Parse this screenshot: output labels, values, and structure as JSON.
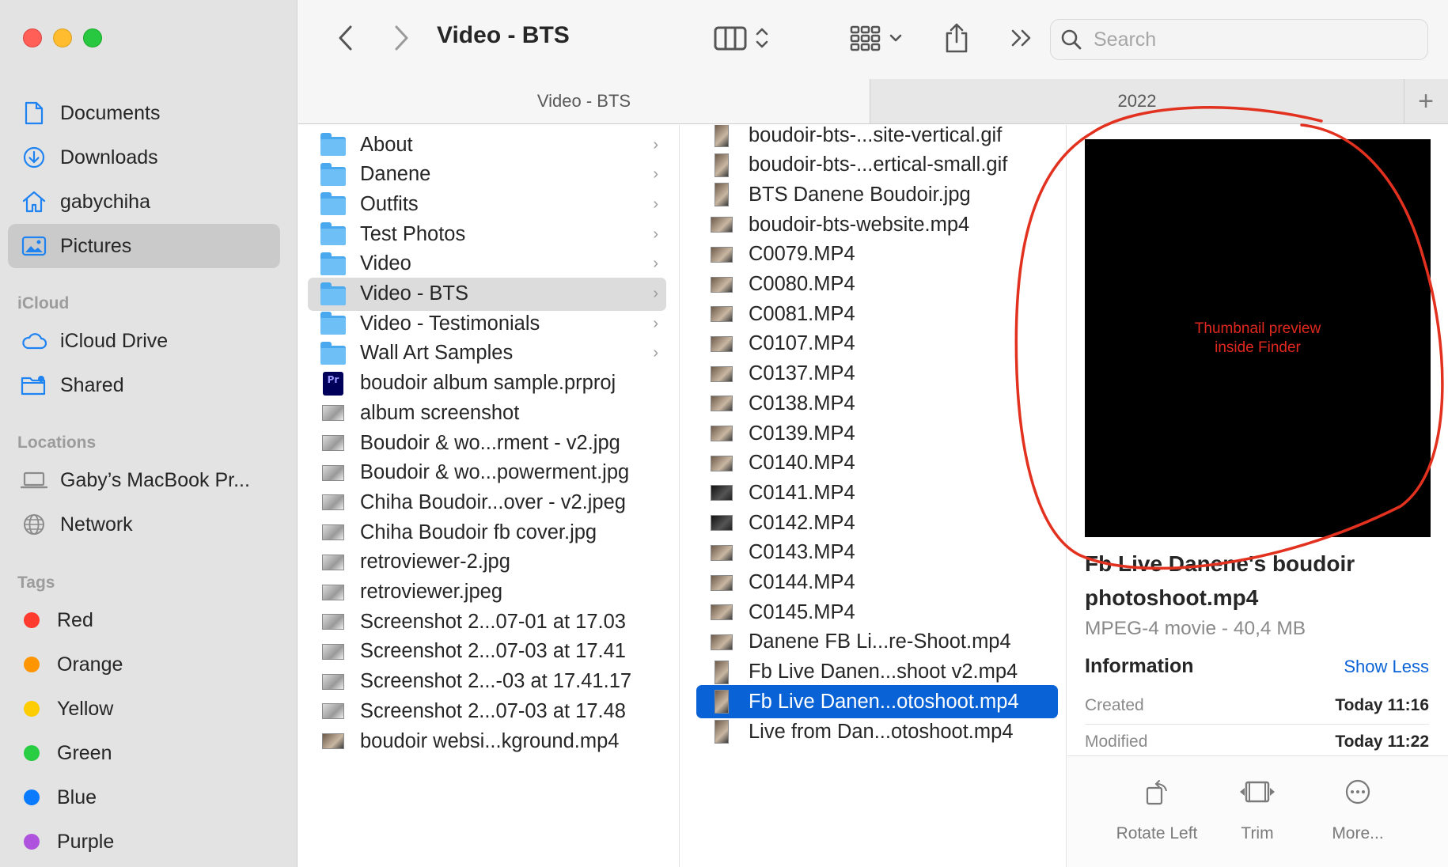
{
  "window": {
    "title": "Video - BTS"
  },
  "toolbar": {
    "search_placeholder": "Search"
  },
  "tabs": [
    {
      "label": "Video - BTS",
      "active": true
    },
    {
      "label": "2022",
      "active": false
    }
  ],
  "sidebar": {
    "items": [
      {
        "label": "Documents",
        "icon": "document-icon"
      },
      {
        "label": "Downloads",
        "icon": "download-icon"
      },
      {
        "label": "gabychiha",
        "icon": "home-icon"
      },
      {
        "label": "Pictures",
        "icon": "pictures-icon",
        "active": true
      }
    ],
    "icloud_header": "iCloud",
    "icloud": [
      {
        "label": "iCloud Drive",
        "icon": "cloud-icon"
      },
      {
        "label": "Shared",
        "icon": "shared-folder-icon"
      }
    ],
    "locations_header": "Locations",
    "locations": [
      {
        "label": "Gaby’s MacBook Pr...",
        "icon": "laptop-icon"
      },
      {
        "label": "Network",
        "icon": "globe-icon"
      }
    ],
    "tags_header": "Tags",
    "tags": [
      {
        "label": "Red",
        "color": "#ff3b30"
      },
      {
        "label": "Orange",
        "color": "#ff9500"
      },
      {
        "label": "Yellow",
        "color": "#ffcc00"
      },
      {
        "label": "Green",
        "color": "#28cd41"
      },
      {
        "label": "Blue",
        "color": "#0a7aff"
      },
      {
        "label": "Purple",
        "color": "#af52de"
      }
    ]
  },
  "column1": [
    {
      "label": "About",
      "kind": "folder"
    },
    {
      "label": "Danene",
      "kind": "folder"
    },
    {
      "label": "Outfits",
      "kind": "folder"
    },
    {
      "label": "Test Photos",
      "kind": "folder"
    },
    {
      "label": "Video",
      "kind": "folder"
    },
    {
      "label": "Video - BTS",
      "kind": "folder",
      "selected": true
    },
    {
      "label": "Video - Testimonials",
      "kind": "folder"
    },
    {
      "label": "Wall Art Samples",
      "kind": "folder"
    },
    {
      "label": "boudoir album sample.prproj",
      "kind": "prproj",
      "badge": "Pr"
    },
    {
      "label": "album screenshot",
      "kind": "image"
    },
    {
      "label": "Boudoir & wo...rment - v2.jpg",
      "kind": "image"
    },
    {
      "label": "Boudoir & wo...powerment.jpg",
      "kind": "image"
    },
    {
      "label": "Chiha Boudoir...over - v2.jpeg",
      "kind": "image"
    },
    {
      "label": "Chiha Boudoir fb cover.jpg",
      "kind": "image"
    },
    {
      "label": "retroviewer-2.jpg",
      "kind": "image"
    },
    {
      "label": "retroviewer.jpeg",
      "kind": "image"
    },
    {
      "label": "Screenshot 2...07-01 at 17.03",
      "kind": "image"
    },
    {
      "label": "Screenshot 2...07-03 at 17.41",
      "kind": "image"
    },
    {
      "label": "Screenshot 2...-03 at 17.41.17",
      "kind": "image"
    },
    {
      "label": "Screenshot 2...07-03 at 17.48",
      "kind": "image"
    },
    {
      "label": "boudoir websi...kground.mp4",
      "kind": "video"
    }
  ],
  "column2": [
    {
      "label": "boudoir-bts-...site-vertical.gif",
      "kind": "portrait"
    },
    {
      "label": "boudoir-bts-...ertical-small.gif",
      "kind": "portrait"
    },
    {
      "label": "BTS Danene Boudoir.jpg",
      "kind": "portrait"
    },
    {
      "label": "boudoir-bts-website.mp4",
      "kind": "video"
    },
    {
      "label": "C0079.MP4",
      "kind": "video"
    },
    {
      "label": "C0080.MP4",
      "kind": "video"
    },
    {
      "label": "C0081.MP4",
      "kind": "video"
    },
    {
      "label": "C0107.MP4",
      "kind": "video"
    },
    {
      "label": "C0137.MP4",
      "kind": "video"
    },
    {
      "label": "C0138.MP4",
      "kind": "video"
    },
    {
      "label": "C0139.MP4",
      "kind": "video"
    },
    {
      "label": "C0140.MP4",
      "kind": "video"
    },
    {
      "label": "C0141.MP4",
      "kind": "video-dark"
    },
    {
      "label": "C0142.MP4",
      "kind": "video-dark"
    },
    {
      "label": "C0143.MP4",
      "kind": "video"
    },
    {
      "label": "C0144.MP4",
      "kind": "video"
    },
    {
      "label": "C0145.MP4",
      "kind": "video"
    },
    {
      "label": "Danene FB Li...re-Shoot.mp4",
      "kind": "video"
    },
    {
      "label": "Fb Live Danen...shoot v2.mp4",
      "kind": "portrait"
    },
    {
      "label": "Fb Live Danen...otoshoot.mp4",
      "kind": "portrait",
      "selected": true
    },
    {
      "label": "Live from Dan...otoshoot.mp4",
      "kind": "portrait"
    }
  ],
  "preview": {
    "thumbnail_caption": "Thumbnail preview inside Finder",
    "file_name": "Fb Live Danene's boudoir photoshoot.mp4",
    "kind_size": "MPEG-4 movie - 40,4 MB",
    "info_header": "Information",
    "show_less": "Show Less",
    "rows": [
      {
        "key": "Created",
        "value": "Today 11:16"
      },
      {
        "key": "Modified",
        "value": "Today 11:22"
      }
    ],
    "actions": [
      {
        "label": "Rotate Left",
        "icon": "rotate-left-icon"
      },
      {
        "label": "Trim",
        "icon": "trim-icon"
      },
      {
        "label": "More...",
        "icon": "more-icon"
      }
    ]
  }
}
